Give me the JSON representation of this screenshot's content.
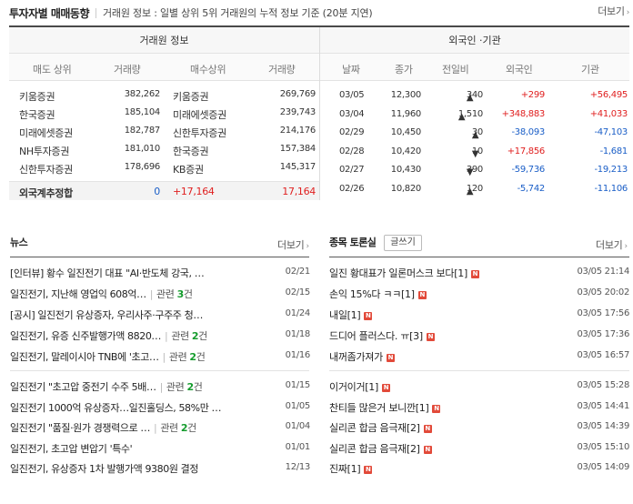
{
  "header": {
    "title": "투자자별 매매동향",
    "description": "거래원 정보 : 일별 상위 5위 거래원의 누적 정보 기준 (20분 지연)",
    "more_label": "더보기"
  },
  "broker": {
    "group_label": "거래원 정보",
    "columns": [
      "매도 상위",
      "거래량",
      "매수상위",
      "거래량"
    ],
    "rows": [
      {
        "sell_name": "키움증권",
        "sell_vol": "382,262",
        "buy_name": "키움증권",
        "buy_vol": "269,769"
      },
      {
        "sell_name": "한국증권",
        "sell_vol": "185,104",
        "buy_name": "미래에셋증권",
        "buy_vol": "239,743"
      },
      {
        "sell_name": "미래에셋증권",
        "sell_vol": "182,787",
        "buy_name": "신한투자증권",
        "buy_vol": "214,176"
      },
      {
        "sell_name": "NH투자증권",
        "sell_vol": "181,010",
        "buy_name": "한국증권",
        "buy_vol": "157,384"
      },
      {
        "sell_name": "신한투자증권",
        "sell_vol": "178,696",
        "buy_name": "KB증권",
        "buy_vol": "145,317"
      }
    ],
    "total": {
      "label": "외국계추정합",
      "sell_vol": "0",
      "diff": "+17,164",
      "buy_vol": "17,164"
    }
  },
  "foreign": {
    "group_label": "외국인 ·기관",
    "columns": [
      "날짜",
      "종가",
      "전일비",
      "외국인",
      "기관"
    ],
    "rows": [
      {
        "date": "03/05",
        "close": "12,300",
        "dir": "up",
        "change": "340",
        "foreign": "+299",
        "inst": "+56,495"
      },
      {
        "date": "03/04",
        "close": "11,960",
        "dir": "up",
        "change": "1,510",
        "foreign": "+348,883",
        "inst": "+41,033"
      },
      {
        "date": "02/29",
        "close": "10,450",
        "dir": "up",
        "change": "30",
        "foreign": "-38,093",
        "inst": "-47,103"
      },
      {
        "date": "02/28",
        "close": "10,420",
        "dir": "down",
        "change": "10",
        "foreign": "+17,856",
        "inst": "-1,681"
      },
      {
        "date": "02/27",
        "close": "10,430",
        "dir": "down",
        "change": "390",
        "foreign": "-59,736",
        "inst": "-19,213"
      },
      {
        "date": "02/26",
        "close": "10,820",
        "dir": "up",
        "change": "120",
        "foreign": "-5,742",
        "inst": "-11,106"
      }
    ]
  },
  "news": {
    "title": "뉴스",
    "more_label": "더보기",
    "related_label": "관련",
    "related_suffix": "건",
    "items": [
      {
        "title": "[인터뷰] 황수 일진전기 대표 \"AI·반도체 강국, …",
        "date": "02/21",
        "related": ""
      },
      {
        "title": "일진전기, 지난해 영업익 608억…",
        "date": "02/15",
        "related": "3"
      },
      {
        "title": "[공시] 일진전기 유상증자, 우리사주·구주주 청…",
        "date": "01/24",
        "related": ""
      },
      {
        "title": "일진전기, 유증 신주발행가액 8820…",
        "date": "01/18",
        "related": "2"
      },
      {
        "title": "일진전기, 말레이시아 TNB에 '초고…",
        "date": "01/16",
        "related": "2"
      },
      {
        "title": "일진전기 \"초고압 중전기 수주 5배…",
        "date": "01/15",
        "related": "2"
      },
      {
        "title": "일진전기 1000억 유상증자…일진홀딩스, 58%만 …",
        "date": "01/05",
        "related": ""
      },
      {
        "title": "일진전기 \"품질·원가 경쟁력으로 …",
        "date": "01/04",
        "related": "2"
      },
      {
        "title": "일진전기, 초고압 변압기 '특수'",
        "date": "01/01",
        "related": ""
      },
      {
        "title": "일진전기, 유상증자 1차 발행가액 9380원 결정",
        "date": "12/13",
        "related": ""
      }
    ]
  },
  "discussion": {
    "title": "종목 토론실",
    "write_label": "글쓰기",
    "more_label": "더보기",
    "badge": "N",
    "items": [
      {
        "title": "일진 황대표가 일론머스크 보다",
        "count": "[1]",
        "date": "03/05 21:14"
      },
      {
        "title": "손익 15%다 ㅋㅋ",
        "count": "[1]",
        "date": "03/05 20:02"
      },
      {
        "title": "내일",
        "count": "[1]",
        "date": "03/05 17:56"
      },
      {
        "title": "드디어 플러스다. ㅠ",
        "count": "[3]",
        "date": "03/05 17:36"
      },
      {
        "title": "내꺼좀가져가",
        "count": "",
        "date": "03/05 16:57"
      },
      {
        "title": "이거이거",
        "count": "[1]",
        "date": "03/05 15:28"
      },
      {
        "title": "찬티들 많은거 보니깐",
        "count": "[1]",
        "date": "03/05 14:41"
      },
      {
        "title": "실리콘 합금 음극재",
        "count": "[2]",
        "date": "03/05 14:39"
      },
      {
        "title": "실리콘 합금 음극재",
        "count": "[2]",
        "date": "03/05 15:10"
      },
      {
        "title": "진짜",
        "count": "[1]",
        "date": "03/05 14:09"
      }
    ]
  },
  "colors": {
    "up": "#e02020",
    "down": "#1a5ec7",
    "related_count": "#159c2d",
    "new_badge": "#e24a3a"
  },
  "icons": {
    "more": "chevron-right-icon",
    "up": "triangle-up-icon",
    "down": "triangle-down-icon"
  }
}
